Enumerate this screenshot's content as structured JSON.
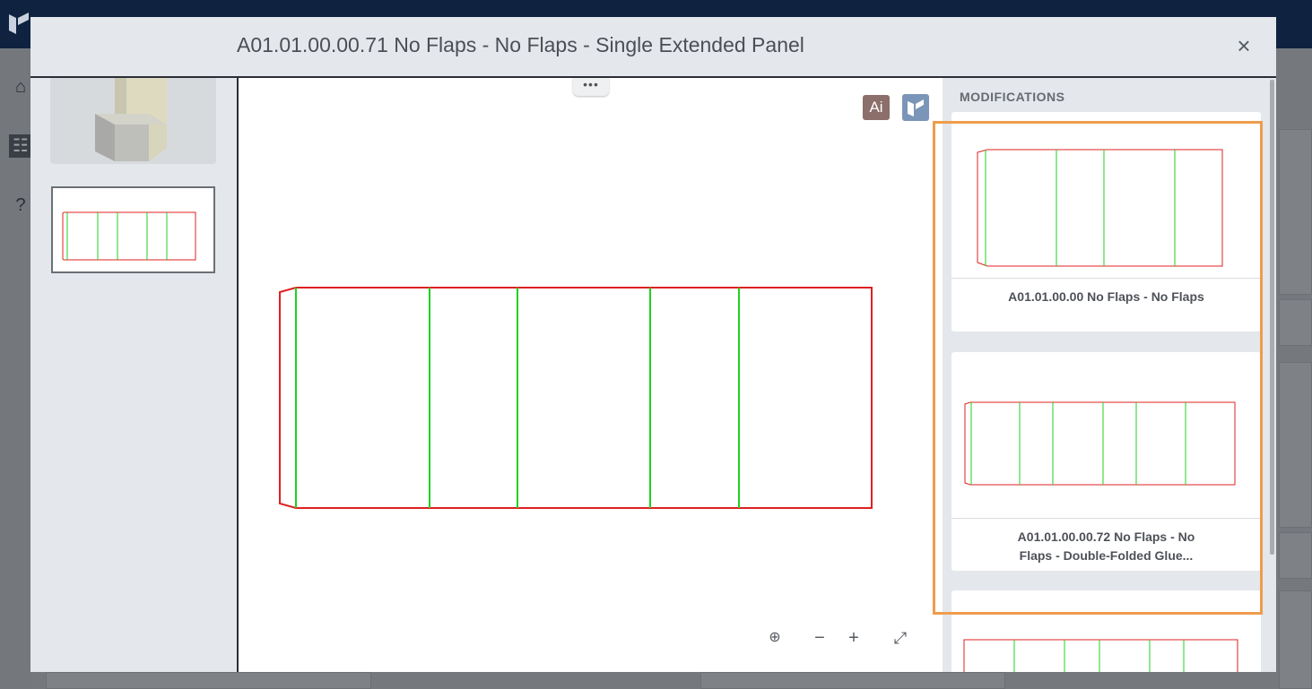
{
  "modal": {
    "title": "A01.01.00.00.71 No Flaps - No Flaps - Single Extended Panel",
    "close_glyph": "×",
    "drag_handle_glyph": "•••"
  },
  "viewer": {
    "ai_label": "Ai",
    "zoom_fit_glyph": "⊕",
    "zoom_out_glyph": "−",
    "zoom_in_glyph": "+",
    "fullscreen_glyph": "⤢"
  },
  "modifications": {
    "heading": "MODIFICATIONS",
    "items": [
      {
        "label": "A01.01.00.00 No Flaps - No Flaps"
      },
      {
        "label": "A01.01.00.00.72 No Flaps - No Flaps - Double-Folded Glue..."
      },
      {
        "label": ""
      }
    ]
  },
  "colors": {
    "cut_line": "#e02020",
    "crease_line": "#20d020",
    "highlight": "#ef9c4d",
    "topbar": "#0f2340"
  },
  "icons": {
    "home": "home-icon",
    "tree": "tree-icon",
    "help": "help-icon",
    "close": "close-icon"
  }
}
